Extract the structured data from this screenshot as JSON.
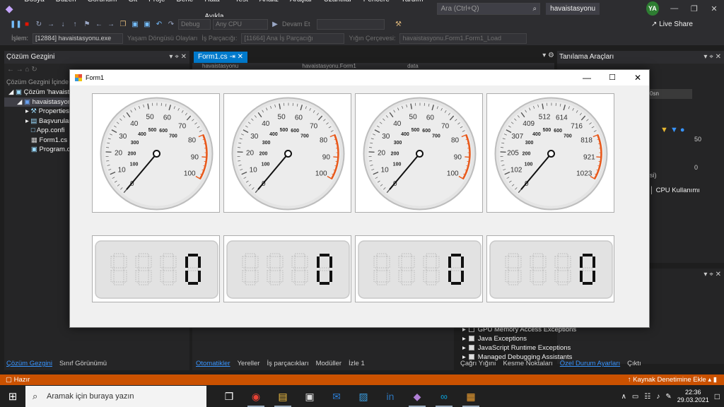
{
  "menubar": {
    "items": [
      "Dosya",
      "Düzen",
      "Görünüm",
      "Git",
      "Proje",
      "Derle",
      "Hata Ayıkla",
      "Test",
      "Analiz",
      "Araçlar",
      "Uzantılar",
      "Pencere",
      "Yardım"
    ],
    "search_placeholder": "Ara (Ctrl+Q)",
    "project_name": "havaistasyonu",
    "user_initials": "YA"
  },
  "toolbar": {
    "config": "Debug",
    "platform": "Any CPU",
    "continue_label": "Devam Et",
    "live_share": "Live Share"
  },
  "procbar": {
    "process_label": "İşlem:",
    "process_value": "[12884] havaistasyonu.exe",
    "lifecycle_label": "Yaşam Döngüsü Olayları",
    "thread_label": "İş Parçacığı:",
    "thread_value": "[11664] Ana İş Parçacığı",
    "stack_label": "Yığın Çerçevesi:",
    "stack_value": "havaistasyonu.Form1.Form1_Load"
  },
  "solution": {
    "title": "Çözüm Gezgini",
    "search": "Çözüm Gezgini İçinde",
    "items": [
      {
        "label": "Çözüm 'havaistas",
        "indent": 0
      },
      {
        "label": "havaistasyonu",
        "indent": 1
      },
      {
        "label": "Properties",
        "indent": 2
      },
      {
        "label": "Başvurular",
        "indent": 2
      },
      {
        "label": "App.confi",
        "indent": 2
      },
      {
        "label": "Form1.cs",
        "indent": 2
      },
      {
        "label": "Program.c",
        "indent": 2
      }
    ],
    "bottom_tabs": [
      "Çözüm Gezgini",
      "Sınıf Görünümü"
    ]
  },
  "editor": {
    "tab_label": "Form1.cs",
    "nav1": "havaistasyonu",
    "nav2": "havaistasyonu.Form1",
    "nav3": "data"
  },
  "diag": {
    "title": "Tanılama Araçları",
    "axis_top": "50",
    "axis_bottom": "0",
    "seconds": "0sn",
    "tab": "CPU Kullanımı",
    "partial": "si)"
  },
  "exceptions": {
    "rows": [
      {
        "label": "GPU Memory Access Exceptions",
        "checked": false
      },
      {
        "label": "Java Exceptions",
        "checked": true
      },
      {
        "label": "JavaScript Runtime Exceptions",
        "checked": true
      },
      {
        "label": "Managed Debugging Assistants",
        "checked": true
      }
    ],
    "tabs": [
      "Çağrı Yığını",
      "Kesme Noktaları",
      "Özel Durum Ayarları",
      "Çıktı"
    ]
  },
  "debugtabs": [
    "Otomatikler",
    "Yereller",
    "İş parçacıkları",
    "Modüller",
    "İzle 1"
  ],
  "statusbar": {
    "left": "Hazır",
    "right": "Kaynak Denetimine Ekle"
  },
  "taskbar": {
    "search_placeholder": "Aramak için buraya yazın",
    "time": "22:36",
    "date": "29.03.2021"
  },
  "form1": {
    "title": "Form1",
    "gauges": [
      {
        "outer": [
          "0",
          "10",
          "20",
          "30",
          "40",
          "50",
          "60",
          "70",
          "80",
          "90",
          "100"
        ],
        "inner": [
          "100",
          "200",
          "300",
          "400",
          "500",
          "600",
          "700"
        ],
        "value": 0
      },
      {
        "outer": [
          "0",
          "10",
          "20",
          "30",
          "40",
          "50",
          "60",
          "70",
          "80",
          "90",
          "100"
        ],
        "inner": [
          "100",
          "200",
          "300",
          "400",
          "500",
          "600",
          "700"
        ],
        "value": 0
      },
      {
        "outer": [
          "0",
          "10",
          "20",
          "30",
          "40",
          "50",
          "60",
          "70",
          "80",
          "90",
          "100"
        ],
        "inner": [
          "100",
          "200",
          "300",
          "400",
          "500",
          "600",
          "700"
        ],
        "value": 0
      },
      {
        "outer": [
          "0",
          "102",
          "205",
          "307",
          "409",
          "512",
          "614",
          "716",
          "818",
          "921",
          "1023"
        ],
        "inner": [
          "100",
          "200",
          "300",
          "400",
          "500",
          "600",
          "700"
        ],
        "value": 0
      }
    ],
    "displays": [
      {
        "value": "0"
      },
      {
        "value": "0"
      },
      {
        "value": "0"
      },
      {
        "value": "0"
      }
    ]
  }
}
